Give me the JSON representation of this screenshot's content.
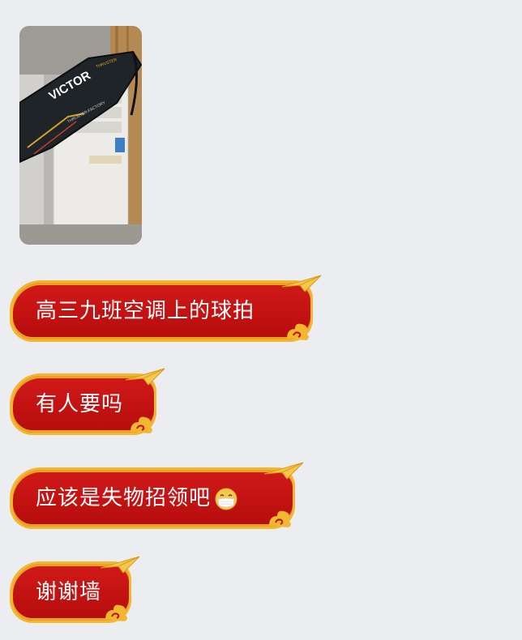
{
  "chat": {
    "photo": {
      "image": "badminton racket bag on air conditioner",
      "icon": "photo-image"
    },
    "messages": [
      {
        "text": "高三九班空调上的球拍"
      },
      {
        "text": "有人要吗"
      },
      {
        "text": "应该是失物招领吧",
        "trailing_emoji": "mask-face-emoji"
      },
      {
        "text": "谢谢墙"
      }
    ],
    "colors": {
      "background": "#ecedf1",
      "bubble_red": "#c81515",
      "bubble_border": "#f2b631",
      "bubble_text": "#ffffff"
    }
  }
}
